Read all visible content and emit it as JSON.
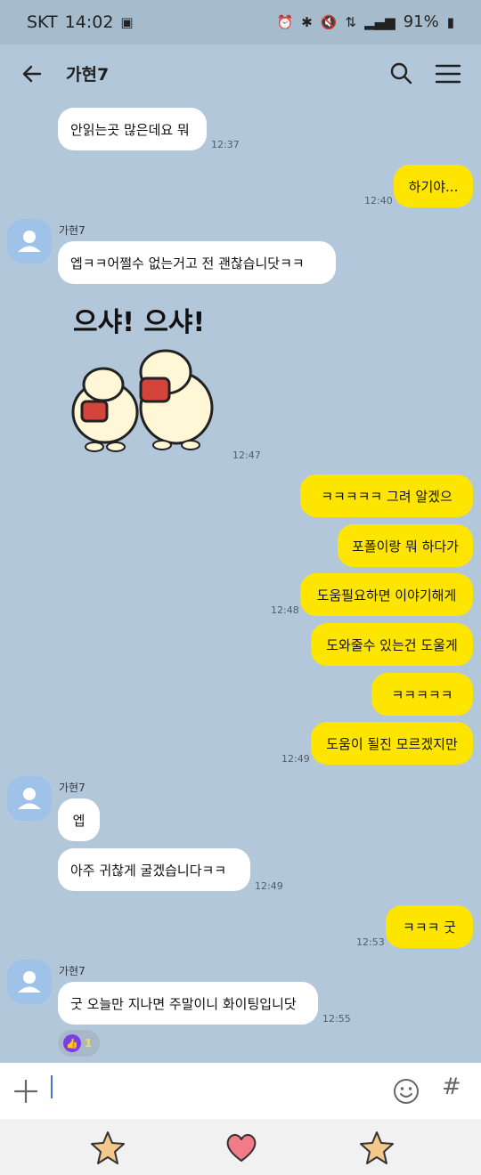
{
  "status_bar": {
    "carrier": "SKT",
    "time": "14:02",
    "battery": "91%"
  },
  "header": {
    "title": "가현7"
  },
  "messages": [
    {
      "text": "안읽는곳 많은데요 뭐",
      "time": "12:37"
    },
    {
      "text": "하기야...",
      "time": "12:40"
    },
    {
      "sender": "가현7",
      "text": "엡ㅋㅋ어쩔수 없는거고 전 괜찮습니닷ㅋㅋ"
    },
    {
      "sticker_text": "으샤! 으샤!",
      "time": "12:47"
    },
    {
      "text": "ㅋㅋㅋㅋㅋ 그려 알겠으"
    },
    {
      "text": "포폴이랑 뭐 하다가"
    },
    {
      "text": "도움필요하면 이야기해게",
      "time": "12:48"
    },
    {
      "text": "도와줄수 있는건 도울게"
    },
    {
      "text": "ㅋㅋㅋㅋㅋ"
    },
    {
      "text": "도움이 될진 모르겠지만",
      "time": "12:49"
    },
    {
      "sender": "가현7",
      "text": "엡"
    },
    {
      "text": "아주 귀찮게 굴겠습니다ㅋㅋ",
      "time": "12:49"
    },
    {
      "text": "ㅋㅋㅋ 굿",
      "time": "12:53"
    },
    {
      "sender": "가현7",
      "text": "굿 오늘만 지나면 주말이니 화이팅입니닷",
      "time": "12:55"
    }
  ],
  "reaction": {
    "count": "1"
  },
  "input": {
    "placeholder": ""
  },
  "colors": {
    "background": "#b2c7d9",
    "my_bubble": "#fee500",
    "their_bubble": "#ffffff"
  }
}
